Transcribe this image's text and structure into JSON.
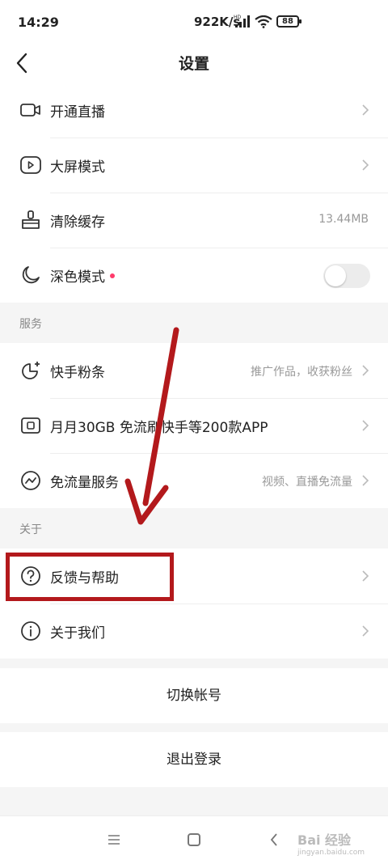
{
  "status": {
    "time": "14:29",
    "speed": "922K/s",
    "battery": "88"
  },
  "header": {
    "title": "设置"
  },
  "group1": [
    {
      "label": "开通直播",
      "icon": "camera-icon"
    },
    {
      "label": "大屏模式",
      "icon": "play-screen-icon"
    },
    {
      "label": "清除缓存",
      "icon": "broom-icon",
      "value": "13.44MB"
    },
    {
      "label": "深色模式",
      "icon": "moon-icon",
      "toggle": false
    }
  ],
  "sections": {
    "services": "服务",
    "about": "关于"
  },
  "services": [
    {
      "label": "快手粉条",
      "icon": "boost-icon",
      "value": "推广作品，收获粉丝"
    },
    {
      "label": "月月30GB 免流刷快手等200款APP",
      "icon": "sim-card-icon"
    },
    {
      "label": "免流量服务",
      "icon": "trend-icon",
      "value": "视频、直播免流量"
    }
  ],
  "about": [
    {
      "label": "反馈与帮助",
      "icon": "question-icon"
    },
    {
      "label": "关于我们",
      "icon": "info-icon"
    }
  ],
  "buttons": {
    "switch_account": "切换帐号",
    "logout": "退出登录"
  },
  "watermark": {
    "text": "Bai 经验",
    "sub": "jingyan.baidu.com"
  },
  "colors": {
    "annotation": "#b3191c",
    "dot": "#ff3b6b"
  }
}
